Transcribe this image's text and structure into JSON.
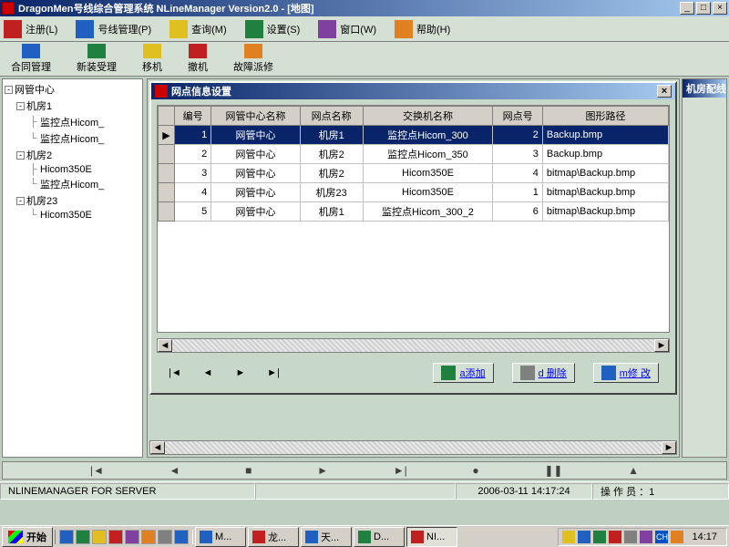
{
  "app": {
    "title": "DragonMen号线综合管理系统 NLineManager Version2.0 - [地图]"
  },
  "menu": [
    {
      "label": "注册(L)"
    },
    {
      "label": "号线管理(P)"
    },
    {
      "label": "查询(M)"
    },
    {
      "label": "设置(S)"
    },
    {
      "label": "窗口(W)"
    },
    {
      "label": "帮助(H)"
    }
  ],
  "toolbar": [
    {
      "label": "合同管理"
    },
    {
      "label": "新装受理"
    },
    {
      "label": "移机"
    },
    {
      "label": "撤机"
    },
    {
      "label": "故障派修"
    }
  ],
  "tree": {
    "root": "网管中心",
    "nodes": [
      {
        "label": "机房1",
        "children": [
          "监控点Hicom_",
          "监控点Hicom_"
        ]
      },
      {
        "label": "机房2",
        "children": [
          "Hicom350E",
          "监控点Hicom_"
        ]
      },
      {
        "label": "机房23",
        "children": [
          "Hicom350E"
        ]
      }
    ]
  },
  "subwin": {
    "title": "网点信息设置",
    "headers": [
      "编号",
      "网管中心名称",
      "网点名称",
      "交换机名称",
      "网点号",
      "图形路径"
    ],
    "rows": [
      {
        "n": "1",
        "c": "网管中心",
        "p": "机房1",
        "s": "监控点Hicom_300",
        "no": "2",
        "img": "Backup.bmp"
      },
      {
        "n": "2",
        "c": "网管中心",
        "p": "机房2",
        "s": "监控点Hicom_350",
        "no": "3",
        "img": "Backup.bmp"
      },
      {
        "n": "3",
        "c": "网管中心",
        "p": "机房2",
        "s": "Hicom350E",
        "no": "4",
        "img": "bitmap\\Backup.bmp"
      },
      {
        "n": "4",
        "c": "网管中心",
        "p": "机房23",
        "s": "Hicom350E",
        "no": "1",
        "img": "bitmap\\Backup.bmp"
      },
      {
        "n": "5",
        "c": "网管中心",
        "p": "机房1",
        "s": "监控点Hicom_300_2",
        "no": "6",
        "img": "bitmap\\Backup.bmp"
      }
    ],
    "actions": {
      "add": "a添加",
      "del": "d 删除",
      "mod": "m修 改"
    }
  },
  "right_strip": {
    "title": "机房配线"
  },
  "status": {
    "app": "NLINEMANAGER  FOR  SERVER",
    "datetime": "2006-03-11 14:17:24",
    "operator": "操 作 员 ：1"
  },
  "taskbar": {
    "start": "开始",
    "tasks": [
      "M...",
      "龙...",
      "天...",
      "D...",
      "NI..."
    ],
    "clock": "14:17",
    "input": "CH"
  }
}
